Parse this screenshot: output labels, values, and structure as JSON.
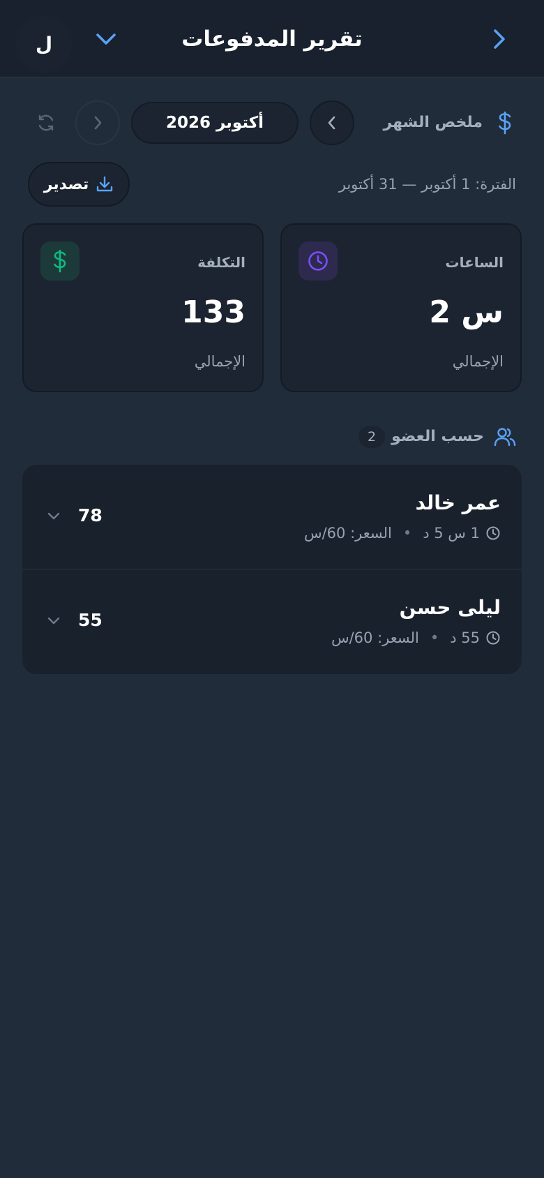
{
  "header": {
    "title": "تقرير المدفوعات",
    "avatar_letter": "ل",
    "back_icon": "chevron-right-icon",
    "menu_icon": "chevron-down-icon"
  },
  "summary": {
    "label": "ملخص الشهر",
    "icon": "dollar-icon",
    "month": "أكتوبر 2026",
    "period": "الفترة: 1 أكتوبر — 31 أكتوبر",
    "export_label": "تصدير"
  },
  "stats": {
    "hours": {
      "label": "الساعات",
      "value": "2 س",
      "sub": "الإجمالي",
      "icon": "clock-icon"
    },
    "cost": {
      "label": "التكلفة",
      "value": "133",
      "sub": "الإجمالي",
      "icon": "dollar-icon"
    }
  },
  "members_section": {
    "title": "حسب العضو",
    "count": "2",
    "icon": "users-icon"
  },
  "members": [
    {
      "name": "عمر خالد",
      "duration": "1 س 5 د",
      "rate": "السعر: 60/س",
      "amount": "78"
    },
    {
      "name": "ليلى حسن",
      "duration": "55 د",
      "rate": "السعر: 60/س",
      "amount": "55"
    }
  ],
  "colors": {
    "background": "#212c3b",
    "header": "#18212d",
    "card": "#1b2430",
    "accent_blue": "#5aa2f5",
    "accent_purple": "#7c4dff",
    "accent_green": "#10b981",
    "muted_text": "#97a3b3"
  }
}
